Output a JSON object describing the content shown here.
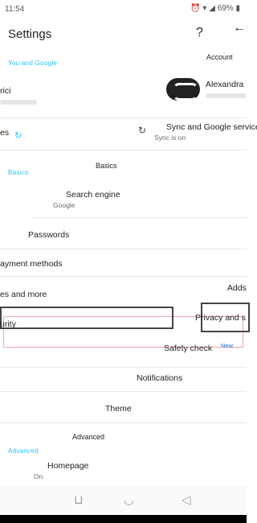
{
  "status_bar": {
    "time": "11:54",
    "battery": "69%"
  },
  "header": {
    "title": "Settings",
    "help_icon": "help-icon",
    "back_icon": "back-arrow-icon"
  },
  "sections": {
    "you_and_google": "Account",
    "basics": "Basics",
    "advanced": "Advanced"
  },
  "account": {
    "name": "Alexandra"
  },
  "sync": {
    "title": "Sync and Google services",
    "subtitle": "Sync is on"
  },
  "search_engine": {
    "title": "Search engine",
    "subtitle": "Google"
  },
  "items": {
    "passwords": "Passwords",
    "payment_methods": "Payment methods",
    "addresses": "Addresses and more",
    "privacy": "Privacy and security",
    "safety_check": "Safety check",
    "new_badge": "New",
    "notifications": "Notifications",
    "theme": "Theme",
    "homepage": "Homepage",
    "homepage_sub": "On"
  },
  "ghost_text": {
    "sync_left": "es",
    "privacy_left": "urity",
    "addresses_left": "es and more",
    "payment_left": "ayment methods",
    "adds_right": "Adds",
    "privacy_right": "Privacy and s",
    "row_left": "rici"
  }
}
